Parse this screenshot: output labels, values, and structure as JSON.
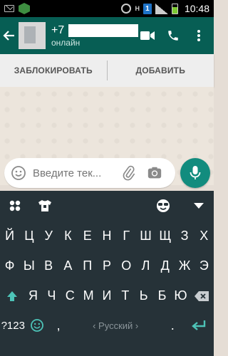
{
  "status_bar": {
    "network": "H",
    "sim": "1",
    "time": "10:48"
  },
  "toolbar": {
    "phone_prefix": "+7",
    "status": "онлайн",
    "icons": {
      "back": "back-arrow-icon",
      "video": "video-call-icon",
      "call": "phone-icon",
      "menu": "more-vert-icon"
    }
  },
  "block_bar": {
    "block_label": "ЗАБЛОКИРОВАТЬ",
    "add_label": "ДОБАВИТЬ"
  },
  "input": {
    "placeholder": "Введите тек...",
    "icons": {
      "emoji": "emoji-icon",
      "attach": "paperclip-icon",
      "camera": "camera-icon",
      "mic": "mic-icon"
    }
  },
  "keyboard": {
    "row1": [
      "Й",
      "Ц",
      "У",
      "К",
      "Е",
      "Н",
      "Г",
      "Ш",
      "Щ",
      "З",
      "Х"
    ],
    "row2": [
      "Ф",
      "Ы",
      "В",
      "А",
      "П",
      "Р",
      "О",
      "Л",
      "Д",
      "Ж",
      "Э"
    ],
    "row3": [
      "Я",
      "Ч",
      "С",
      "М",
      "И",
      "Т",
      "Ь",
      "Б",
      "Ю"
    ],
    "sym_label": "?123",
    "comma": ",",
    "space_label": "‹ Русский ›",
    "period": "."
  },
  "colors": {
    "toolbar": "#075e54",
    "accent": "#128c7e",
    "keyboard": "#263238"
  }
}
